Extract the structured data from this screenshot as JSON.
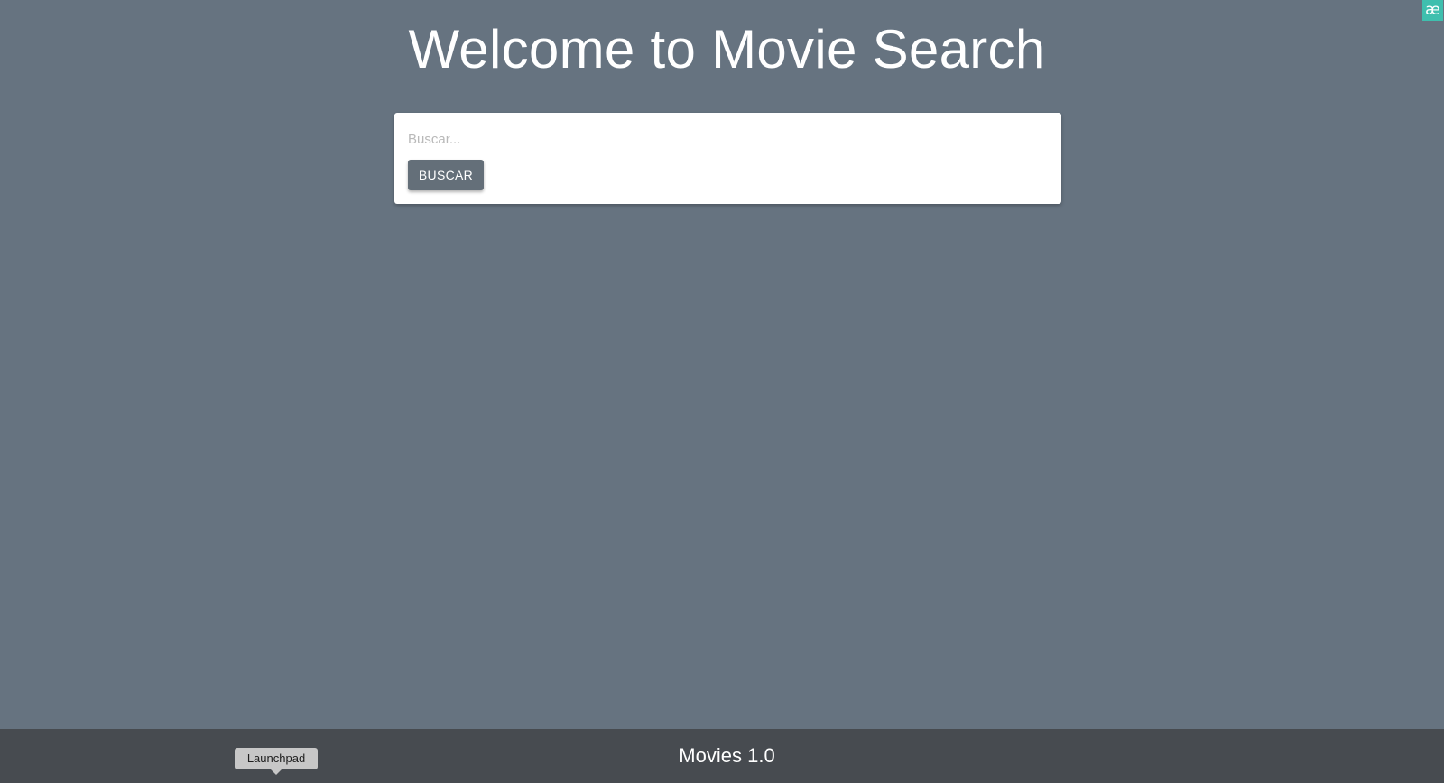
{
  "page": {
    "title": "Welcome to Movie Search"
  },
  "search": {
    "placeholder": "Buscar...",
    "value": "",
    "button_label": "BUSCAR"
  },
  "corner_badge": {
    "glyph": "æ",
    "icon": "ae-extension-icon",
    "color": "#3fbfae"
  },
  "footer": {
    "title": "Movies 1.0",
    "tooltip": "Launchpad"
  },
  "colors": {
    "background": "#667380",
    "footer": "#474b50",
    "button": "#646f79"
  }
}
